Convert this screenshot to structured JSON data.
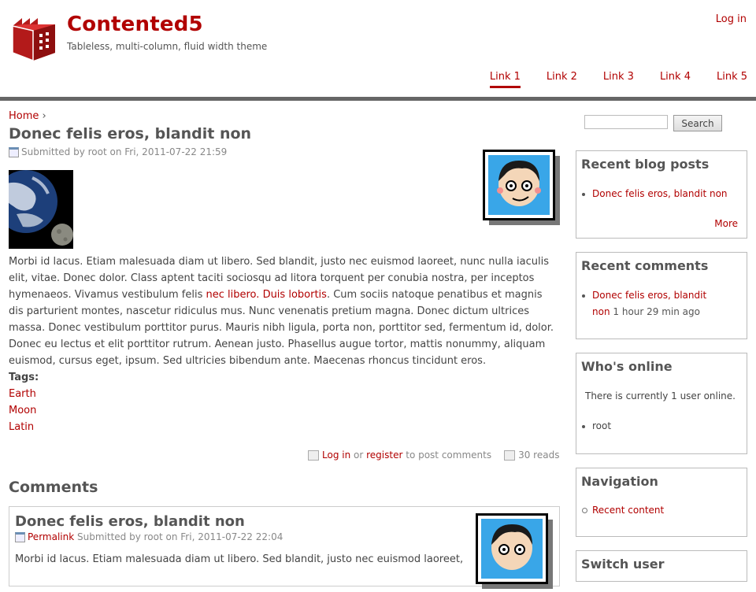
{
  "site": {
    "name": "Contented5",
    "slogan": "Tableless, multi-column, fluid width theme",
    "login": "Log in"
  },
  "primary_links": [
    {
      "label": "Link 1",
      "active": true
    },
    {
      "label": "Link 2",
      "active": false
    },
    {
      "label": "Link 3",
      "active": false
    },
    {
      "label": "Link 4",
      "active": false
    },
    {
      "label": "Link 5",
      "active": false
    }
  ],
  "breadcrumb": {
    "home": "Home",
    "separator": "›"
  },
  "node": {
    "title": "Donec felis eros, blandit non",
    "submitted": "Submitted by root on Fri, 2011-07-22 21:59",
    "body_before": "Morbi id lacus. Etiam malesuada diam ut libero. Sed blandit, justo nec euismod laoreet, nunc nulla iaculis elit, vitae. Donec dolor. Class aptent taciti sociosqu ad litora torquent per conubia nostra, per inceptos hymenaeos. Vivamus vestibulum felis ",
    "link_1": "nec libero.",
    "link_2": "Duis lobortis",
    "body_after": ". Cum sociis natoque penatibus et magnis dis parturient montes, nascetur ridiculus mus. Nunc venenatis pretium magna. Donec dictum ultrices massa. Donec vestibulum porttitor purus. Mauris nibh ligula, porta non, porttitor sed, fermentum id, dolor. Donec eu lectus et elit porttitor rutrum. Aenean justo. Phasellus augue tortor, mattis nonummy, aliquam euismod, cursus eget, ipsum. Sed ultricies bibendum ante. Maecenas rhoncus tincidunt eros.",
    "tags_label": "Tags:",
    "tags": [
      "Earth",
      "Moon",
      "Latin"
    ],
    "links": {
      "login": "Log in",
      "or": "or",
      "register": "register",
      "to_post": "to post comments",
      "reads": "30 reads"
    }
  },
  "comments": {
    "heading": "Comments",
    "first": {
      "title": "Donec felis eros, blandit non",
      "permalink": "Permalink",
      "submitted": "Submitted by root on Fri, 2011-07-22 22:04",
      "body": "Morbi id lacus. Etiam malesuada diam ut libero. Sed blandit, justo nec euismod laoreet,"
    }
  },
  "search": {
    "button": "Search",
    "value": ""
  },
  "sidebar": {
    "recent_blog": {
      "title": "Recent blog posts",
      "items": [
        "Donec felis eros, blandit non"
      ],
      "more": "More"
    },
    "recent_comments": {
      "title": "Recent comments",
      "item_line1": "Donec felis eros, blandit",
      "item_line2": "non",
      "item_time": "1 hour 29 min ago"
    },
    "who_online": {
      "title": "Who's online",
      "text": "There is currently 1 user online.",
      "users": [
        "root"
      ]
    },
    "navigation": {
      "title": "Navigation",
      "items": [
        "Recent content"
      ]
    },
    "switch_user": {
      "title": "Switch user"
    }
  },
  "colors": {
    "accent": "#b10000",
    "bar": "#666666",
    "text": "#444444"
  }
}
